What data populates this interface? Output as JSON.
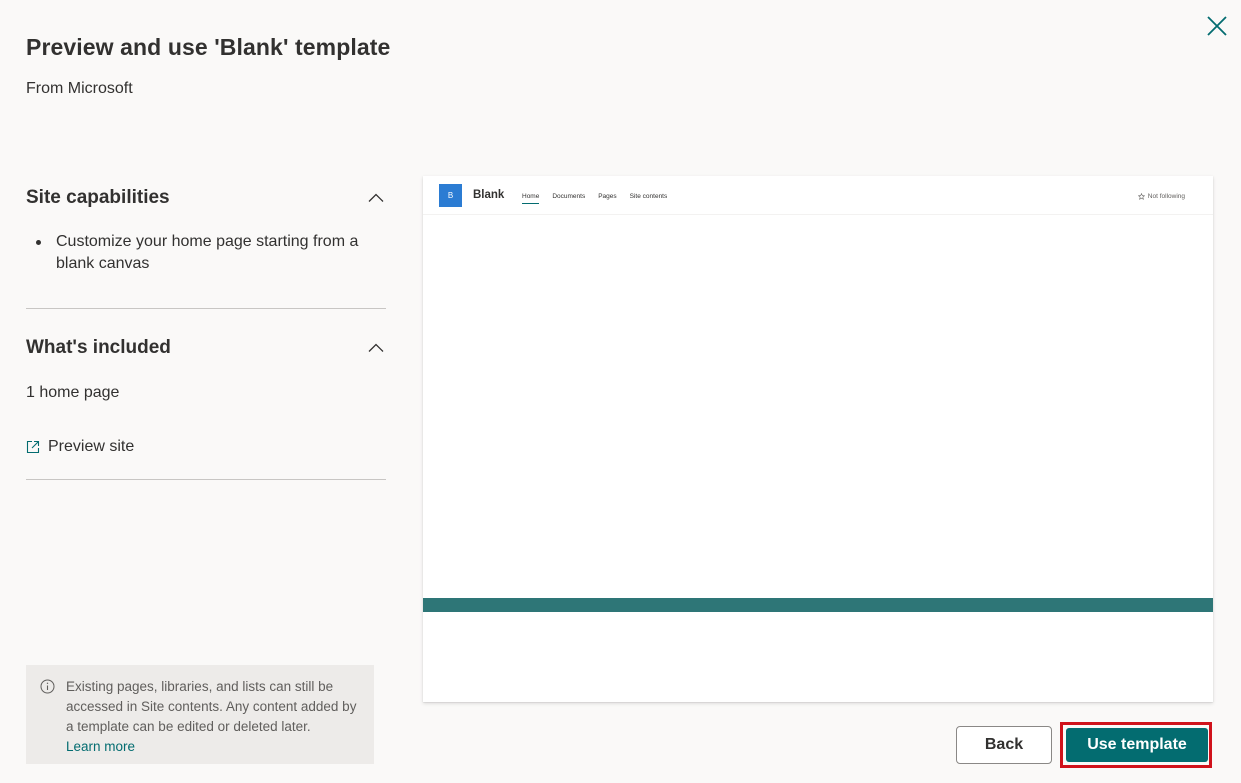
{
  "panel": {
    "title": "Preview and use 'Blank' template",
    "subtitle": "From Microsoft"
  },
  "capabilities": {
    "heading": "Site capabilities",
    "items": [
      "Customize your home page starting from a blank canvas"
    ]
  },
  "included": {
    "heading": "What's included",
    "text": "1 home page",
    "preview_link": "Preview site"
  },
  "info": {
    "text": "Existing pages, libraries, and lists can still be accessed in Site contents. Any content added by a template can be edited or deleted later.",
    "link": "Learn more"
  },
  "preview": {
    "logo_letter": "B",
    "site_name": "Blank",
    "nav": [
      "Home",
      "Documents",
      "Pages",
      "Site contents"
    ],
    "follow_label": "Not following",
    "accent": "#2e7677"
  },
  "buttons": {
    "back": "Back",
    "use_template": "Use template"
  },
  "colors": {
    "primary": "#036c70",
    "highlight": "#d0121b",
    "logo": "#2b7cd3"
  }
}
